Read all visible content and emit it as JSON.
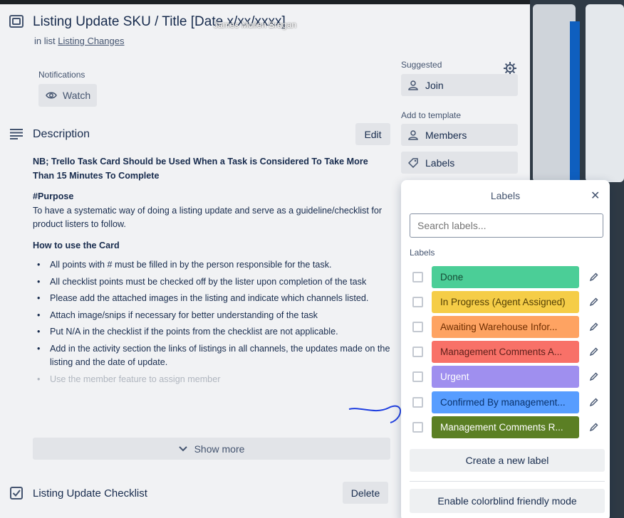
{
  "card": {
    "title": "Listing Update SKU / Title [Date x/xx/xxxx]",
    "presenter_overlay": "James Mullen Bragan",
    "in_list_prefix": "in list",
    "list_name": "Listing Changes",
    "notifications_label": "Notifications",
    "watch_label": "Watch"
  },
  "description": {
    "title": "Description",
    "edit_label": "Edit",
    "bold_note": "NB; Trello Task Card Should be Used When a Task is Considered To Take More Than 15 Minutes To Complete",
    "purpose_heading": "#Purpose",
    "purpose_text": "To have a systematic way of doing a listing update and serve as a guideline/checklist for product listers to follow.",
    "howto_heading": "How to use the Card",
    "bullets": [
      "All points with # must be filled in by the person responsible for the task.",
      "All checklist points must be checked off by the lister upon completion of the task",
      "Please add the attached images in the listing and indicate which channels listed.",
      "Attach image/snips if necessary for better understanding of the task",
      "Put N/A in the checklist if the points from the checklist are not applicable.",
      "Add in the activity section the links of listings in all channels, the updates made on the listing and the date of update.",
      "Use the member feature to assign member"
    ],
    "show_more_label": "Show more"
  },
  "checklist": {
    "title": "Listing Update Checklist",
    "delete_label": "Delete"
  },
  "sidebar": {
    "suggested_label": "Suggested",
    "join_label": "Join",
    "add_to_template_label": "Add to template",
    "members_label": "Members",
    "labels_label": "Labels"
  },
  "labels_popover": {
    "title": "Labels",
    "close_glyph": "✕",
    "search_placeholder": "Search labels...",
    "section_label": "Labels",
    "labels": [
      {
        "name": "Done",
        "color": "#4bce97",
        "text_color": "#164b35"
      },
      {
        "name": "In Progress (Agent Assigned)",
        "color": "#f5cd47",
        "text_color": "#533f04"
      },
      {
        "name": "Awaiting Warehouse Infor...",
        "color": "#fea362",
        "text_color": "#702e00"
      },
      {
        "name": "Management Comments A...",
        "color": "#f87168",
        "text_color": "#5d1f1a"
      },
      {
        "name": "Urgent",
        "color": "#9f8fef",
        "text_color": "#ffffff"
      },
      {
        "name": "Confirmed By management...",
        "color": "#579dff",
        "text_color": "#09326c"
      },
      {
        "name": "Management Comments R...",
        "color": "#5b7f24",
        "text_color": "#ffffff"
      }
    ],
    "create_label": "Create a new label",
    "colorblind_label": "Enable colorblind friendly mode"
  },
  "colors": {
    "card_bg": "#f1f2f4",
    "button_bg": "#e2e4e8",
    "annotation_ink": "#1f3fe0"
  }
}
